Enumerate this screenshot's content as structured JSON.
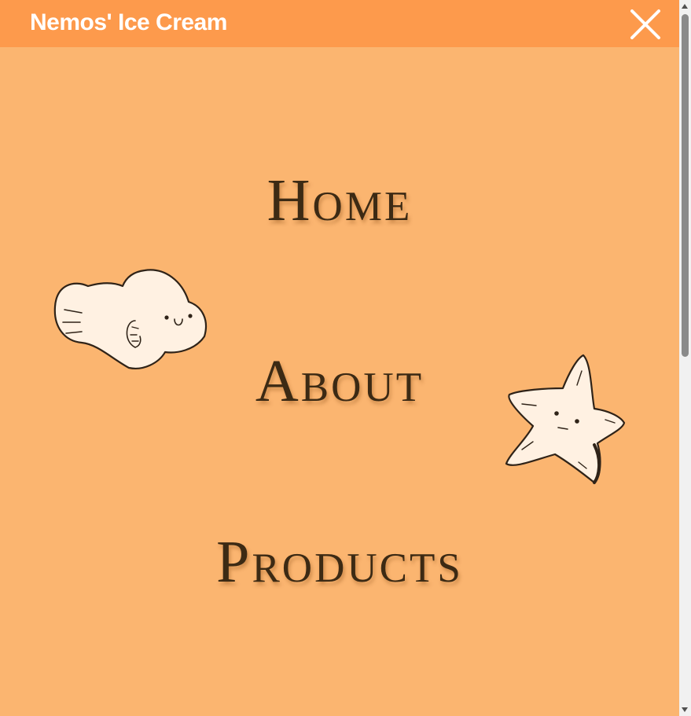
{
  "header": {
    "brand": "Nemos' Ice Cream",
    "close_icon": "close-icon"
  },
  "menu": {
    "items": [
      {
        "label": "Home"
      },
      {
        "label": "About"
      },
      {
        "label": "Products"
      }
    ]
  },
  "decorations": {
    "fish": "fish-illustration",
    "star": "starfish-illustration"
  },
  "colors": {
    "header_bg": "#fd9a4c",
    "page_bg": "#fbb570",
    "link_text": "#3c2a14",
    "brand_text": "#ffffff",
    "doodle_fill": "#fff1e2"
  }
}
